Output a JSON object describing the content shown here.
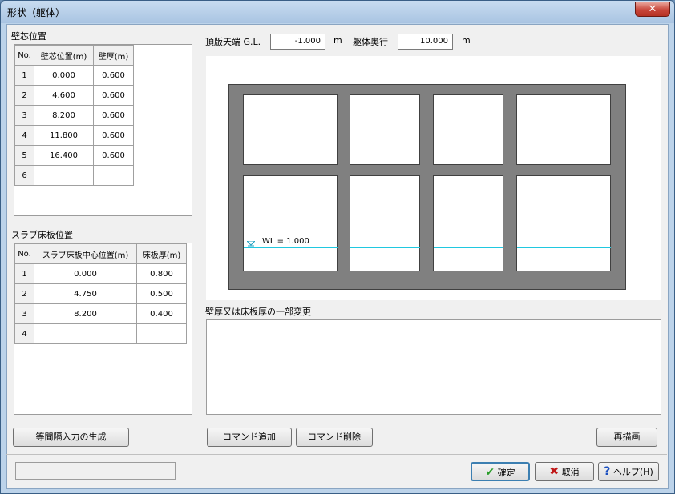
{
  "window": {
    "title": "形状（躯体）",
    "close": "✕"
  },
  "wall": {
    "section_label": "壁芯位置",
    "headers": [
      "No.",
      "壁芯位置(m)",
      "壁厚(m)"
    ],
    "rows": [
      [
        "1",
        "0.000",
        "0.600"
      ],
      [
        "2",
        "4.600",
        "0.600"
      ],
      [
        "3",
        "8.200",
        "0.600"
      ],
      [
        "4",
        "11.800",
        "0.600"
      ],
      [
        "5",
        "16.400",
        "0.600"
      ],
      [
        "6",
        "",
        ""
      ]
    ]
  },
  "slab": {
    "section_label": "スラブ床板位置",
    "headers": [
      "No.",
      "スラブ床板中心位置(m)",
      "床板厚(m)"
    ],
    "rows": [
      [
        "1",
        "0.000",
        "0.800"
      ],
      [
        "2",
        "4.750",
        "0.500"
      ],
      [
        "3",
        "8.200",
        "0.400"
      ],
      [
        "4",
        "",
        ""
      ]
    ]
  },
  "top": {
    "top_label": "頂版天端 G.L.",
    "top_value": "-1.000",
    "unit1": "m",
    "depth_label": "躯体奥行",
    "depth_value": "10.000",
    "unit2": "m"
  },
  "drawing": {
    "wl_label": "WL = 1.000"
  },
  "changes": {
    "label": "壁厚又は床板厚の一部変更"
  },
  "buttons": {
    "generate": "等間隔入力の生成",
    "add_command": "コマンド追加",
    "delete_command": "コマンド削除",
    "redraw": "再描画",
    "ok": "確定",
    "cancel": "取消",
    "help": "ヘルプ(H)"
  },
  "colors": {
    "concrete": "#808080",
    "water": "#20c8e0",
    "ok_check": "#2a9d2a",
    "cancel_x": "#c01818",
    "help_q": "#1a4fc0"
  }
}
